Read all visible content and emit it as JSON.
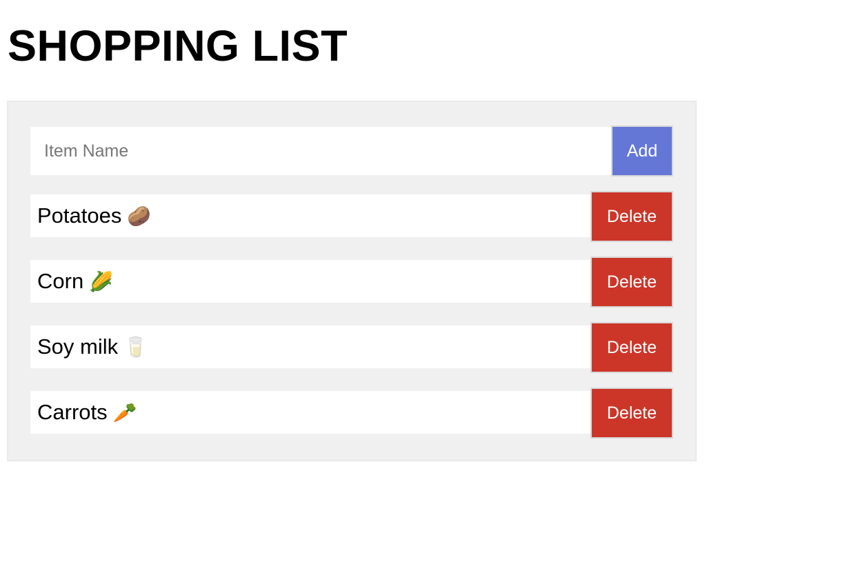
{
  "page": {
    "title": "SHOPPING LIST"
  },
  "form": {
    "input_placeholder": "Item Name",
    "input_value": "",
    "add_label": "Add"
  },
  "items": [
    {
      "name": "Potatoes",
      "emoji": "🥔",
      "icon": "potato-icon",
      "delete_label": "Delete"
    },
    {
      "name": "Corn",
      "emoji": "🌽",
      "icon": "corn-icon",
      "delete_label": "Delete"
    },
    {
      "name": "Soy milk",
      "emoji": "🥛",
      "icon": "milk-glass-icon",
      "delete_label": "Delete"
    },
    {
      "name": "Carrots",
      "emoji": "🥕",
      "icon": "carrot-icon",
      "delete_label": "Delete"
    }
  ],
  "colors": {
    "add_button": "#6577d6",
    "delete_button": "#cc3629",
    "panel_background": "#f0f0f0"
  }
}
